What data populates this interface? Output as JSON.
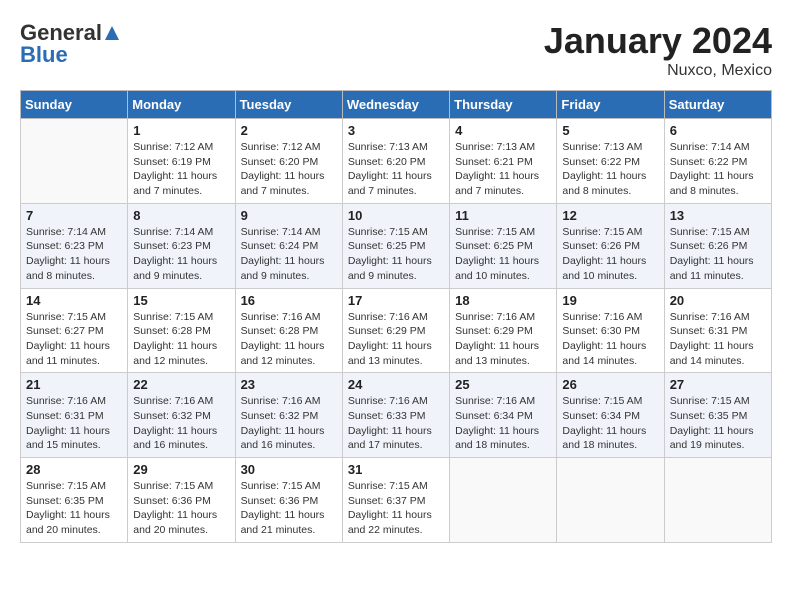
{
  "header": {
    "logo_general": "General",
    "logo_blue": "Blue",
    "month_title": "January 2024",
    "location": "Nuxco, Mexico"
  },
  "days_of_week": [
    "Sunday",
    "Monday",
    "Tuesday",
    "Wednesday",
    "Thursday",
    "Friday",
    "Saturday"
  ],
  "weeks": [
    [
      {
        "day": "",
        "info": ""
      },
      {
        "day": "1",
        "info": "Sunrise: 7:12 AM\nSunset: 6:19 PM\nDaylight: 11 hours\nand 7 minutes."
      },
      {
        "day": "2",
        "info": "Sunrise: 7:12 AM\nSunset: 6:20 PM\nDaylight: 11 hours\nand 7 minutes."
      },
      {
        "day": "3",
        "info": "Sunrise: 7:13 AM\nSunset: 6:20 PM\nDaylight: 11 hours\nand 7 minutes."
      },
      {
        "day": "4",
        "info": "Sunrise: 7:13 AM\nSunset: 6:21 PM\nDaylight: 11 hours\nand 7 minutes."
      },
      {
        "day": "5",
        "info": "Sunrise: 7:13 AM\nSunset: 6:22 PM\nDaylight: 11 hours\nand 8 minutes."
      },
      {
        "day": "6",
        "info": "Sunrise: 7:14 AM\nSunset: 6:22 PM\nDaylight: 11 hours\nand 8 minutes."
      }
    ],
    [
      {
        "day": "7",
        "info": "Sunrise: 7:14 AM\nSunset: 6:23 PM\nDaylight: 11 hours\nand 8 minutes."
      },
      {
        "day": "8",
        "info": "Sunrise: 7:14 AM\nSunset: 6:23 PM\nDaylight: 11 hours\nand 9 minutes."
      },
      {
        "day": "9",
        "info": "Sunrise: 7:14 AM\nSunset: 6:24 PM\nDaylight: 11 hours\nand 9 minutes."
      },
      {
        "day": "10",
        "info": "Sunrise: 7:15 AM\nSunset: 6:25 PM\nDaylight: 11 hours\nand 9 minutes."
      },
      {
        "day": "11",
        "info": "Sunrise: 7:15 AM\nSunset: 6:25 PM\nDaylight: 11 hours\nand 10 minutes."
      },
      {
        "day": "12",
        "info": "Sunrise: 7:15 AM\nSunset: 6:26 PM\nDaylight: 11 hours\nand 10 minutes."
      },
      {
        "day": "13",
        "info": "Sunrise: 7:15 AM\nSunset: 6:26 PM\nDaylight: 11 hours\nand 11 minutes."
      }
    ],
    [
      {
        "day": "14",
        "info": "Sunrise: 7:15 AM\nSunset: 6:27 PM\nDaylight: 11 hours\nand 11 minutes."
      },
      {
        "day": "15",
        "info": "Sunrise: 7:15 AM\nSunset: 6:28 PM\nDaylight: 11 hours\nand 12 minutes."
      },
      {
        "day": "16",
        "info": "Sunrise: 7:16 AM\nSunset: 6:28 PM\nDaylight: 11 hours\nand 12 minutes."
      },
      {
        "day": "17",
        "info": "Sunrise: 7:16 AM\nSunset: 6:29 PM\nDaylight: 11 hours\nand 13 minutes."
      },
      {
        "day": "18",
        "info": "Sunrise: 7:16 AM\nSunset: 6:29 PM\nDaylight: 11 hours\nand 13 minutes."
      },
      {
        "day": "19",
        "info": "Sunrise: 7:16 AM\nSunset: 6:30 PM\nDaylight: 11 hours\nand 14 minutes."
      },
      {
        "day": "20",
        "info": "Sunrise: 7:16 AM\nSunset: 6:31 PM\nDaylight: 11 hours\nand 14 minutes."
      }
    ],
    [
      {
        "day": "21",
        "info": "Sunrise: 7:16 AM\nSunset: 6:31 PM\nDaylight: 11 hours\nand 15 minutes."
      },
      {
        "day": "22",
        "info": "Sunrise: 7:16 AM\nSunset: 6:32 PM\nDaylight: 11 hours\nand 16 minutes."
      },
      {
        "day": "23",
        "info": "Sunrise: 7:16 AM\nSunset: 6:32 PM\nDaylight: 11 hours\nand 16 minutes."
      },
      {
        "day": "24",
        "info": "Sunrise: 7:16 AM\nSunset: 6:33 PM\nDaylight: 11 hours\nand 17 minutes."
      },
      {
        "day": "25",
        "info": "Sunrise: 7:16 AM\nSunset: 6:34 PM\nDaylight: 11 hours\nand 18 minutes."
      },
      {
        "day": "26",
        "info": "Sunrise: 7:15 AM\nSunset: 6:34 PM\nDaylight: 11 hours\nand 18 minutes."
      },
      {
        "day": "27",
        "info": "Sunrise: 7:15 AM\nSunset: 6:35 PM\nDaylight: 11 hours\nand 19 minutes."
      }
    ],
    [
      {
        "day": "28",
        "info": "Sunrise: 7:15 AM\nSunset: 6:35 PM\nDaylight: 11 hours\nand 20 minutes."
      },
      {
        "day": "29",
        "info": "Sunrise: 7:15 AM\nSunset: 6:36 PM\nDaylight: 11 hours\nand 20 minutes."
      },
      {
        "day": "30",
        "info": "Sunrise: 7:15 AM\nSunset: 6:36 PM\nDaylight: 11 hours\nand 21 minutes."
      },
      {
        "day": "31",
        "info": "Sunrise: 7:15 AM\nSunset: 6:37 PM\nDaylight: 11 hours\nand 22 minutes."
      },
      {
        "day": "",
        "info": ""
      },
      {
        "day": "",
        "info": ""
      },
      {
        "day": "",
        "info": ""
      }
    ]
  ]
}
